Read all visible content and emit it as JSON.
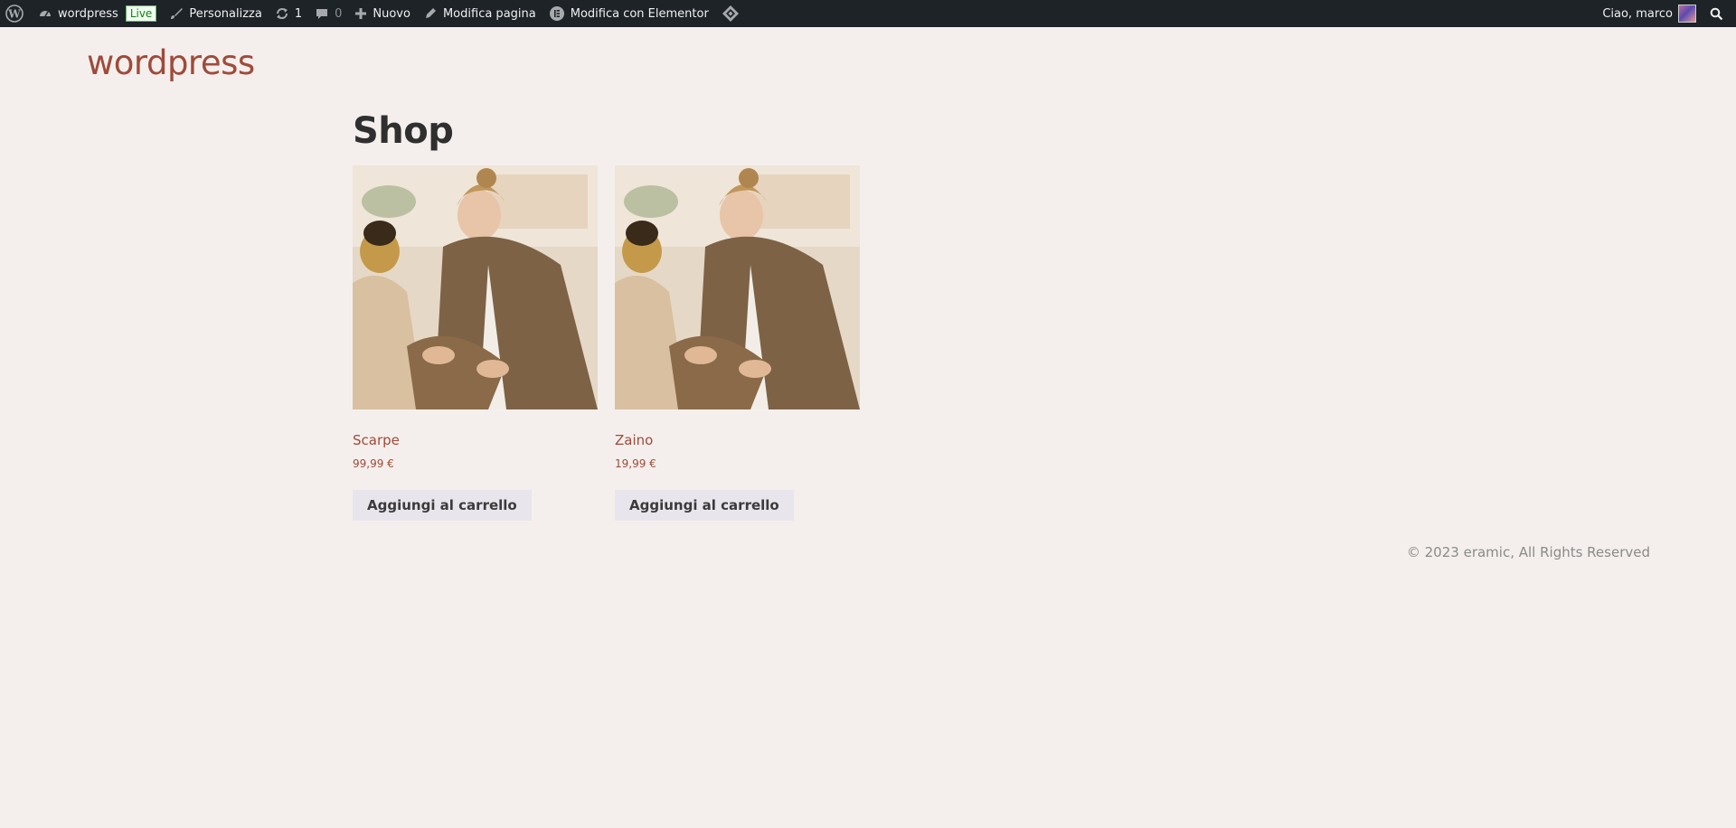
{
  "admin_bar": {
    "site_name": "wordpress",
    "live_badge": "Live",
    "customize": "Personalizza",
    "updates_count": "1",
    "comments_count": "0",
    "new": "Nuovo",
    "edit_page": "Modifica pagina",
    "edit_elementor": "Modifica con Elementor",
    "greeting": "Ciao, marco"
  },
  "site": {
    "title": "wordpress"
  },
  "page": {
    "title": "Shop"
  },
  "products": [
    {
      "name": "Scarpe",
      "price": "99,99 €",
      "button": "Aggiungi al carrello"
    },
    {
      "name": "Zaino",
      "price": "19,99 €",
      "button": "Aggiungi al carrello"
    }
  ],
  "footer": {
    "copyright": "© 2023 eramic, All Rights Reserved"
  },
  "colors": {
    "admin_bar_bg": "#1d2327",
    "page_bg": "#f4efec",
    "accent": "#a04a3a",
    "button_bg": "#e8e5ec"
  }
}
